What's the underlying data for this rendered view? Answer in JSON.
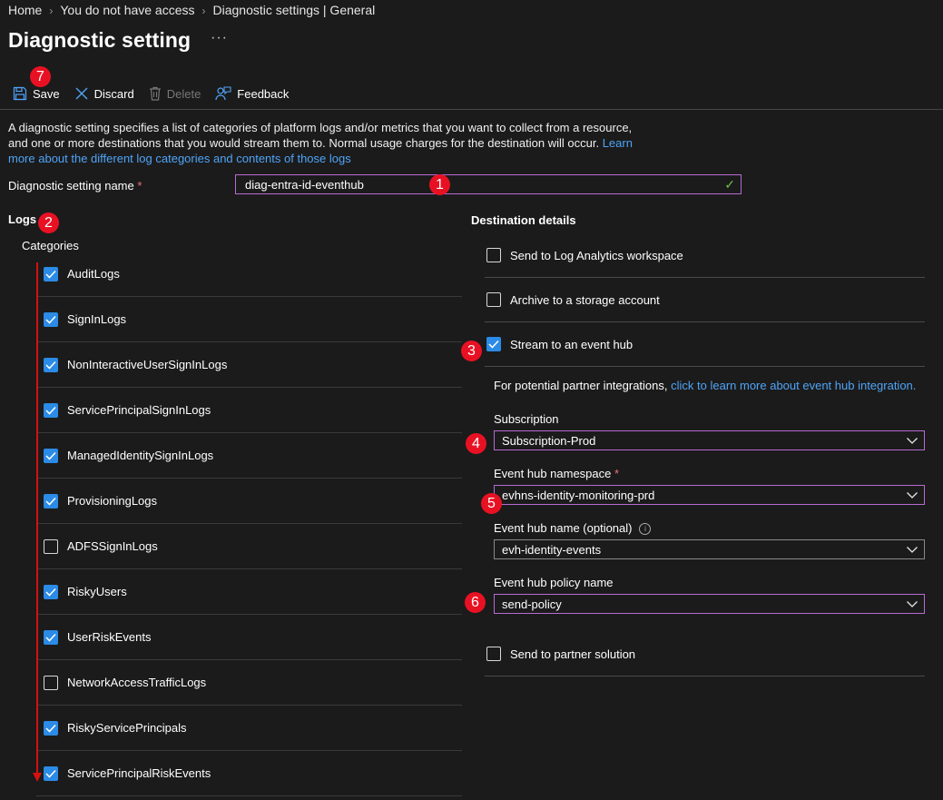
{
  "breadcrumb": [
    "Home",
    "You do not have access",
    "Diagnostic settings | General"
  ],
  "page_title": "Diagnostic setting",
  "more_label": "···",
  "toolbar": {
    "save_label": "Save",
    "discard_label": "Discard",
    "delete_label": "Delete",
    "feedback_label": "Feedback"
  },
  "description": {
    "text": "A diagnostic setting specifies a list of categories of platform logs and/or metrics that you want to collect from a resource, and one or more destinations that you would stream them to. Normal usage charges for the destination will occur.",
    "link": "Learn more about the different log categories and contents of those logs"
  },
  "setting_name": {
    "label": "Diagnostic setting name",
    "required_mark": "*",
    "value": "diag-entra-id-eventhub"
  },
  "logs": {
    "heading": "Logs",
    "categories_label": "Categories",
    "items": [
      {
        "label": "AuditLogs",
        "checked": true
      },
      {
        "label": "SignInLogs",
        "checked": true
      },
      {
        "label": "NonInteractiveUserSignInLogs",
        "checked": true
      },
      {
        "label": "ServicePrincipalSignInLogs",
        "checked": true
      },
      {
        "label": "ManagedIdentitySignInLogs",
        "checked": true
      },
      {
        "label": "ProvisioningLogs",
        "checked": true
      },
      {
        "label": "ADFSSignInLogs",
        "checked": false
      },
      {
        "label": "RiskyUsers",
        "checked": true
      },
      {
        "label": "UserRiskEvents",
        "checked": true
      },
      {
        "label": "NetworkAccessTrafficLogs",
        "checked": false
      },
      {
        "label": "RiskyServicePrincipals",
        "checked": true
      },
      {
        "label": "ServicePrincipalRiskEvents",
        "checked": true
      }
    ]
  },
  "destination": {
    "heading": "Destination details",
    "options": [
      {
        "label": "Send to Log Analytics workspace",
        "checked": false
      },
      {
        "label": "Archive to a storage account",
        "checked": false
      },
      {
        "label": "Stream to an event hub",
        "checked": true
      }
    ],
    "partner_text": "For potential partner integrations,",
    "partner_link": "click to learn more about event hub integration.",
    "subscription": {
      "label": "Subscription",
      "value": "Subscription-Prod"
    },
    "namespace": {
      "label": "Event hub namespace",
      "required_mark": "*",
      "value": "evhns-identity-monitoring-prd"
    },
    "hub_name": {
      "label": "Event hub name (optional)",
      "value": "evh-identity-events"
    },
    "policy": {
      "label": "Event hub policy name",
      "value": "send-policy"
    },
    "partner_solution": {
      "label": "Send to partner solution",
      "checked": false
    }
  },
  "badges": [
    "1",
    "2",
    "3",
    "4",
    "5",
    "6",
    "7"
  ],
  "colors": {
    "accent": "#2b8be6",
    "badge": "#e81123",
    "focus_border": "#b86ad3",
    "link": "#4fa4f7"
  }
}
